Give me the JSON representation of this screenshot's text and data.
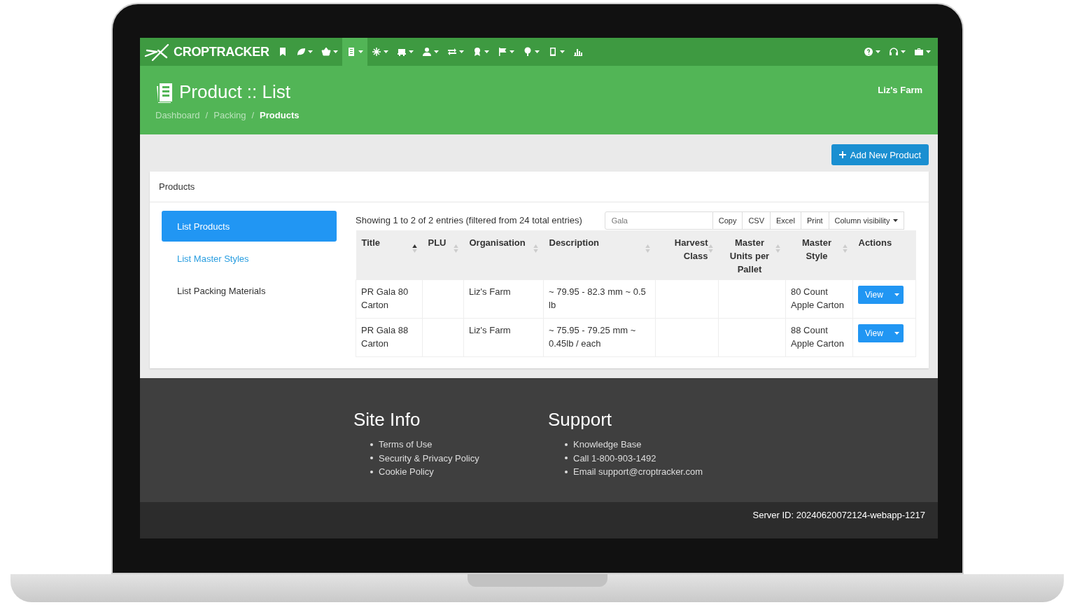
{
  "navbar": {
    "brand": "CROPTRACKER",
    "items": [
      {
        "dropdown": false,
        "selected": false
      },
      {
        "dropdown": true,
        "selected": false
      },
      {
        "dropdown": true,
        "selected": false
      },
      {
        "dropdown": true,
        "selected": true
      },
      {
        "dropdown": true,
        "selected": false
      },
      {
        "dropdown": true,
        "selected": false
      },
      {
        "dropdown": true,
        "selected": false
      },
      {
        "dropdown": true,
        "selected": false
      },
      {
        "dropdown": true,
        "selected": false
      },
      {
        "dropdown": true,
        "selected": false
      },
      {
        "dropdown": true,
        "selected": false
      },
      {
        "dropdown": true,
        "selected": false
      },
      {
        "dropdown": false,
        "selected": false
      }
    ],
    "right_items": [
      {
        "dropdown": true
      },
      {
        "dropdown": true
      },
      {
        "dropdown": true
      }
    ]
  },
  "header": {
    "title": "Product :: List",
    "farm": "Liz's Farm",
    "separator": "/",
    "breadcrumbs": [
      {
        "label": "Dashboard",
        "current": false
      },
      {
        "label": "Packing",
        "current": false
      },
      {
        "label": "Products",
        "current": true
      }
    ]
  },
  "add_button": "Add New Product",
  "panel": {
    "title": "Products",
    "menu": [
      {
        "label": "List Products",
        "selected": true,
        "link": false
      },
      {
        "label": "List Master Styles",
        "selected": false,
        "link": true
      },
      {
        "label": "List Packing Materials",
        "selected": false,
        "link": false
      }
    ],
    "info": "Showing 1 to 2 of 2 entries (filtered from 24 total entries)",
    "search": {
      "value": "Gala"
    },
    "export_buttons": [
      "Copy",
      "CSV",
      "Excel",
      "Print"
    ],
    "column_visibility": "Column visibility",
    "table": {
      "columns": [
        {
          "label": "Title",
          "sortable": true,
          "sorted": true
        },
        {
          "label": "PLU",
          "sortable": true,
          "sorted": false
        },
        {
          "label": "Organisation",
          "sortable": true,
          "sorted": false
        },
        {
          "label": "Description",
          "sortable": true,
          "sorted": false
        },
        {
          "label": "Harvest Class",
          "sortable": true,
          "sorted": false
        },
        {
          "label": "Master Units per Pallet",
          "sortable": true,
          "sorted": false
        },
        {
          "label": "Master Style",
          "sortable": true,
          "sorted": false
        },
        {
          "label": "Actions",
          "sortable": false
        }
      ],
      "rows": [
        {
          "cells": [
            "PR Gala 80 Carton",
            "",
            "Liz's Farm",
            "~ 79.95 - 82.3 mm ~ 0.5 lb",
            "",
            "",
            "80 Count Apple Carton"
          ],
          "action": "View"
        },
        {
          "cells": [
            "PR Gala 88 Carton",
            "",
            "Liz's Farm",
            "~ 75.95 - 79.25 mm ~ 0.45lb / each",
            "",
            "",
            "88 Count Apple Carton"
          ],
          "action": "View"
        }
      ]
    }
  },
  "footer": {
    "columns": [
      {
        "title": "Site Info",
        "links": [
          "Terms of Use",
          "Security & Privacy Policy",
          "Cookie Policy"
        ]
      },
      {
        "title": "Support",
        "links": [
          "Knowledge Base",
          "Call 1-800-903-1492",
          "Email support@croptracker.com"
        ]
      }
    ],
    "server_id": "Server ID: 20240620072124-webapp-1217"
  }
}
